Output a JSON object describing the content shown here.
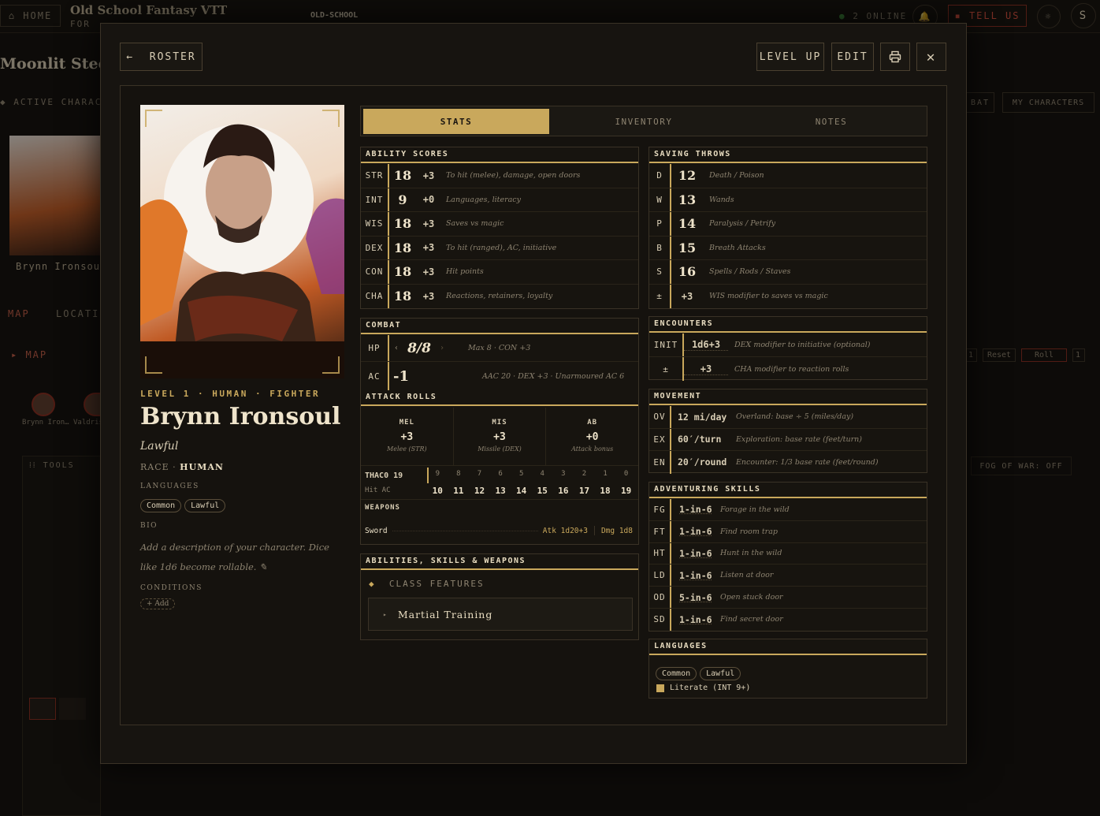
{
  "topbar": {
    "home": "HOME",
    "brand": "Old School Fantasy VTT",
    "brand_sub": "FOR",
    "logo": "OLD-SCHOOL",
    "online": "2 ONLINE",
    "tell_us": "TELL US",
    "avatar": "S"
  },
  "bg": {
    "campaign": "Moonlit Steele",
    "active": "ACTIVE CHARAC",
    "char_name": "Brynn Ironsoul",
    "tab_map": "MAP",
    "tab_loc": "LOCATI",
    "map_label": "MAP",
    "combat": "BAT",
    "my_chars": "MY CHARACTERS",
    "reset": "Reset",
    "roll": "Roll",
    "one_a": "1",
    "one_b": "1",
    "tools": "TOOLS",
    "token1": "Brynn Iron…",
    "token2": "Valdris",
    "fog": "FOG OF WAR: OFF"
  },
  "header": {
    "roster": "ROSTER",
    "level_up": "LEVEL UP",
    "edit": "EDIT"
  },
  "profile": {
    "level_line": "LEVEL 1 · HUMAN · FIGHTER",
    "name": "Brynn Ironsoul",
    "alignment": "Lawful",
    "race_label": "RACE ·",
    "race": "HUMAN",
    "languages_label": "LANGUAGES",
    "languages": [
      "Common",
      "Lawful"
    ],
    "bio_label": "BIO",
    "bio": "Add a description of your character. Dice like 1d6 become rollable.",
    "conditions_label": "CONDITIONS",
    "add": "+ Add"
  },
  "tabs": [
    "STATS",
    "INVENTORY",
    "NOTES"
  ],
  "abilities": {
    "title": "ABILITY SCORES",
    "rows": [
      {
        "abbr": "STR",
        "score": "18",
        "mod": "+3",
        "note": "To hit (melee), damage, open doors"
      },
      {
        "abbr": "INT",
        "score": "9",
        "mod": "+0",
        "note": "Languages, literacy"
      },
      {
        "abbr": "WIS",
        "score": "18",
        "mod": "+3",
        "note": "Saves vs magic"
      },
      {
        "abbr": "DEX",
        "score": "18",
        "mod": "+3",
        "note": "To hit (ranged), AC, initiative"
      },
      {
        "abbr": "CON",
        "score": "18",
        "mod": "+3",
        "note": "Hit points"
      },
      {
        "abbr": "CHA",
        "score": "18",
        "mod": "+3",
        "note": "Reactions, retainers, loyalty"
      }
    ]
  },
  "saves": {
    "title": "SAVING THROWS",
    "rows": [
      {
        "abbr": "D",
        "val": "12",
        "note": "Death / Poison"
      },
      {
        "abbr": "W",
        "val": "13",
        "note": "Wands"
      },
      {
        "abbr": "P",
        "val": "14",
        "note": "Paralysis / Petrify"
      },
      {
        "abbr": "B",
        "val": "15",
        "note": "Breath Attacks"
      },
      {
        "abbr": "S",
        "val": "16",
        "note": "Spells / Rods / Staves"
      },
      {
        "abbr": "±",
        "val": "+3",
        "note": "WIS modifier to saves vs magic"
      }
    ]
  },
  "combat": {
    "title": "COMBAT",
    "hp_label": "HP",
    "hp": "8/8",
    "hp_note": "Max 8 · CON +3",
    "ac_label": "AC",
    "ac": "-1",
    "ac_note": "AAC 20 · DEX +3 · Unarmoured AC 6"
  },
  "encounters": {
    "title": "ENCOUNTERS",
    "rows": [
      {
        "abbr": "INIT",
        "val": "1d6+3",
        "note": "DEX modifier to initiative (optional)"
      },
      {
        "abbr": "±",
        "val": "+3",
        "note": "CHA modifier to reaction rolls"
      }
    ]
  },
  "attacks": {
    "title": "ATTACK ROLLS",
    "cols": [
      {
        "label": "MEL",
        "val": "+3",
        "sub": "Melee (STR)"
      },
      {
        "label": "MIS",
        "val": "+3",
        "sub": "Missile (DEX)"
      },
      {
        "label": "AB",
        "val": "+0",
        "sub": "Attack bonus"
      }
    ],
    "thaco": "THAC0 19",
    "rolls": [
      "9",
      "8",
      "7",
      "6",
      "5",
      "4",
      "3",
      "2",
      "1",
      "0"
    ],
    "hit_ac": "Hit AC",
    "acs": [
      "10",
      "11",
      "12",
      "13",
      "14",
      "15",
      "16",
      "17",
      "18",
      "19"
    ],
    "weapons_label": "WEAPONS",
    "weapon": "Sword",
    "atk": "Atk 1d20+3",
    "dmg": "Dmg 1d8"
  },
  "movement": {
    "title": "MOVEMENT",
    "rows": [
      {
        "abbr": "OV",
        "val": "12 mi/day",
        "note": "Overland: base ÷ 5 (miles/day)"
      },
      {
        "abbr": "EX",
        "val": "60′/turn",
        "note": "Exploration: base rate (feet/turn)"
      },
      {
        "abbr": "EN",
        "val": "20′/round",
        "note": "Encounter: 1/3 base rate (feet/round)"
      }
    ]
  },
  "skills": {
    "title": "ADVENTURING SKILLS",
    "rows": [
      {
        "abbr": "FG",
        "val": "1-in-6",
        "note": "Forage in the wild"
      },
      {
        "abbr": "FT",
        "val": "1-in-6",
        "note": "Find room trap"
      },
      {
        "abbr": "HT",
        "val": "1-in-6",
        "note": "Hunt in the wild"
      },
      {
        "abbr": "LD",
        "val": "1-in-6",
        "note": "Listen at door"
      },
      {
        "abbr": "OD",
        "val": "5-in-6",
        "note": "Open stuck door"
      },
      {
        "abbr": "SD",
        "val": "1-in-6",
        "note": "Find secret door"
      }
    ]
  },
  "abilities_sw": {
    "title": "ABILITIES, SKILLS & WEAPONS",
    "class_features": "CLASS FEATURES",
    "feature": "Martial Training"
  },
  "languages_box": {
    "title": "LANGUAGES",
    "tags": [
      "Common",
      "Lawful"
    ],
    "literate": "Literate (INT 9+)"
  },
  "colors": {
    "accent": "#c9a85c",
    "panel": "#17140f",
    "red": "#8a2a1e"
  }
}
